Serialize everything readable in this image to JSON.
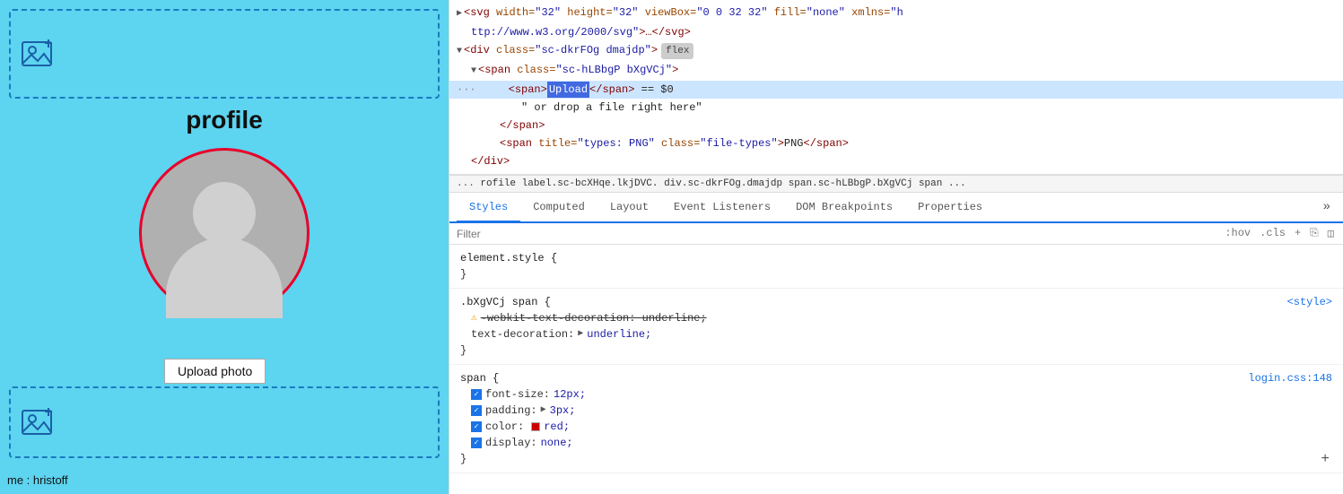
{
  "leftPanel": {
    "profileLabel": "profile",
    "uploadPhotoLabel": "Upload photo",
    "bottomLabel": "me : hristoff"
  },
  "devtools": {
    "htmlLines": [
      {
        "id": "line1",
        "indent": 0,
        "triangle": "▶",
        "content": "<svg width=\"32\" height=\"32\" viewBox=\"0 0 32 32\" fill=\"none\" xmlns=\"h",
        "suffix": "ttp://www.w3.org/2000/svg\">…</svg>"
      },
      {
        "id": "line2",
        "indent": 0,
        "triangle": "▼",
        "content": "<div class=\"sc-dkrFOg dmajdp\">",
        "badge": "flex",
        "selected": false
      },
      {
        "id": "line3",
        "indent": 1,
        "triangle": "▼",
        "content": "<span class=\"sc-hLBbgP bXgVCj\">"
      },
      {
        "id": "line4",
        "indent": 2,
        "dots": "···",
        "spanHighlight": "Upload",
        "spanText": "</span>",
        "equals": "== $0",
        "selected": true
      },
      {
        "id": "line5",
        "indent": 3,
        "text": "\" or drop a file right here\""
      },
      {
        "id": "line6",
        "indent": 2,
        "text": "</span>"
      },
      {
        "id": "line7",
        "indent": 2,
        "text": "<span title=\"types: PNG\" class=\"file-types\">PNG</span>"
      },
      {
        "id": "line8",
        "indent": 1,
        "text": "</div>"
      }
    ],
    "breadcrumb": {
      "items": [
        "... rofile",
        "label.sc-bcXHqe.lkjDVC.",
        "div.sc-dkrFOg.dmajdp",
        "span.sc-hLBbgP.bXgVCj",
        "span",
        "..."
      ]
    },
    "tabs": [
      {
        "id": "styles",
        "label": "Styles",
        "active": true
      },
      {
        "id": "computed",
        "label": "Computed",
        "active": false
      },
      {
        "id": "layout",
        "label": "Layout",
        "active": false
      },
      {
        "id": "event-listeners",
        "label": "Event Listeners",
        "active": false
      },
      {
        "id": "dom-breakpoints",
        "label": "DOM Breakpoints",
        "active": false
      },
      {
        "id": "properties",
        "label": "Properties",
        "active": false
      },
      {
        "id": "more",
        "label": "»",
        "active": false
      }
    ],
    "filter": {
      "placeholder": "Filter",
      "hov": ":hov",
      "cls": ".cls"
    },
    "styleBlocks": [
      {
        "id": "element-style",
        "selector": "element.style {",
        "closeBrace": "}",
        "properties": []
      },
      {
        "id": "bxgvcj-span",
        "selector": ".bXgVCj span {",
        "source": "<style>",
        "closeBrace": "}",
        "properties": [
          {
            "id": "webkit-text-decoration",
            "hasCheckbox": false,
            "hasWarning": true,
            "name": "-webkit-text-decoration: underline;",
            "strikethrough": true
          },
          {
            "id": "text-decoration",
            "hasCheckbox": false,
            "hasWarning": false,
            "name": "text-decoration:",
            "value": "▶ underline;",
            "hasExpand": true
          }
        ]
      },
      {
        "id": "span",
        "selector": "span {",
        "source": "login.css:148",
        "closeBrace": "}",
        "properties": [
          {
            "id": "font-size",
            "hasCheckbox": true,
            "name": "font-size:",
            "value": "12px;"
          },
          {
            "id": "padding",
            "hasCheckbox": true,
            "name": "padding:",
            "value": "▶ 3px;",
            "hasExpand": true
          },
          {
            "id": "color",
            "hasCheckbox": true,
            "name": "color:",
            "value": "red;",
            "hasColorSwatch": true,
            "swatchColor": "#cc0000"
          },
          {
            "id": "display",
            "hasCheckbox": true,
            "name": "display:",
            "value": "none;"
          }
        ]
      }
    ],
    "addBtn": "+"
  }
}
